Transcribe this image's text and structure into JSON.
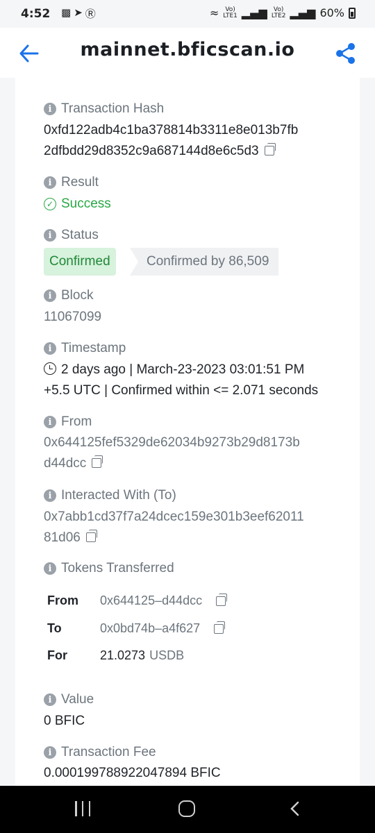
{
  "status_bar": {
    "time": "4:52",
    "battery": "60%",
    "sim1": "Vo) R LTE1",
    "sim2": "Vo) R LTE2"
  },
  "app_bar": {
    "title": "mainnet.bficscan.io",
    "accent_color": "#1a73e8"
  },
  "fields": {
    "tx_hash": {
      "label": "Transaction Hash",
      "line1": "0xfd122adb4c1ba378814b3311e8e013b7fb",
      "line2": "2dfbdd29d8352c9a687144d8e6c5d3"
    },
    "result": {
      "label": "Result",
      "value": "Success"
    },
    "status": {
      "label": "Status",
      "badge": "Confirmed",
      "confirmations": "Confirmed by 86,509"
    },
    "block": {
      "label": "Block",
      "value": "11067099"
    },
    "timestamp": {
      "label": "Timestamp",
      "line1": "2 days ago | March-23-2023 03:01:51 PM",
      "line2": "+5.5 UTC | Confirmed within <= 2.071 seconds"
    },
    "from": {
      "label": "From",
      "line1": "0x644125fef5329de62034b9273b29d8173b",
      "line2": "d44dcc"
    },
    "interacted_with": {
      "label": "Interacted With (To)",
      "line1": "0x7abb1cd37f7a24dcec159e301b3eef62011",
      "line2": "81d06"
    },
    "tokens_transferred": {
      "label": "Tokens Transferred",
      "rows": [
        {
          "key": "From",
          "value": "0x644125–d44dcc"
        },
        {
          "key": "To",
          "value": "0x0bd74b–a4f627"
        }
      ],
      "for_key": "For",
      "amount": "21.0273",
      "token": "USDB"
    },
    "value": {
      "label": "Value",
      "value": "0 BFIC"
    },
    "fee": {
      "label": "Transaction Fee",
      "value": "0.000199788922047894 BFIC"
    }
  }
}
